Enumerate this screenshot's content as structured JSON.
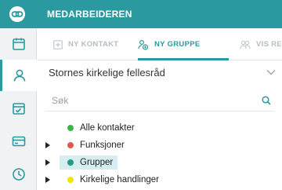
{
  "header": {
    "title": "MEDARBEIDEREN",
    "logo_icon": "chain-link-icon"
  },
  "colors": {
    "accent": "#2a9aa0",
    "selected_bg": "#d6eef0"
  },
  "sidebar": {
    "items": [
      {
        "icon": "calendar-icon",
        "active": false
      },
      {
        "icon": "person-icon",
        "active": true
      },
      {
        "icon": "calendar-check-icon",
        "active": false
      },
      {
        "icon": "card-icon",
        "active": false
      },
      {
        "icon": "clock-icon",
        "active": false
      }
    ]
  },
  "tabs": [
    {
      "label": "NY KONTAKT",
      "icon": "plus-icon",
      "active": false
    },
    {
      "label": "NY GRUPPE",
      "icon": "add-group-icon",
      "active": true
    },
    {
      "label": "VIS RE",
      "icon": "group-icon",
      "active": false
    }
  ],
  "organization": {
    "label": "Stornes kirkelige fellesråd"
  },
  "search": {
    "placeholder": "Søk",
    "value": ""
  },
  "tree": {
    "items": [
      {
        "label": "Alle kontakter",
        "color": "#3cb54a",
        "expandable": false,
        "selected": false
      },
      {
        "label": "Funksjoner",
        "color": "#e05a52",
        "expandable": true,
        "selected": false
      },
      {
        "label": "Grupper",
        "color": "#1f9a8c",
        "expandable": true,
        "selected": true
      },
      {
        "label": "Kirkelige handlinger",
        "color": "#f2e500",
        "expandable": true,
        "selected": false
      }
    ]
  }
}
